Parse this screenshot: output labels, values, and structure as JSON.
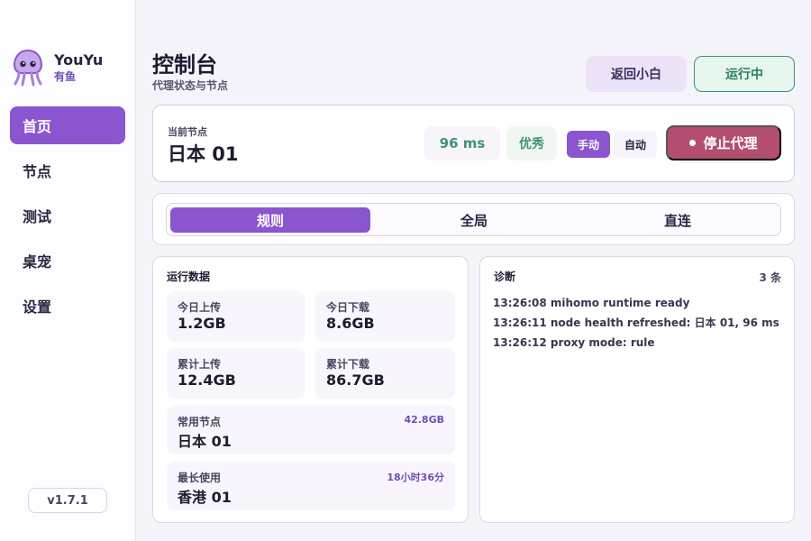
{
  "brand": {
    "name": "YouYu",
    "sub": "有鱼"
  },
  "sidebar": {
    "items": [
      {
        "label": "首页",
        "active": true
      },
      {
        "label": "节点",
        "active": false
      },
      {
        "label": "测试",
        "active": false
      },
      {
        "label": "桌宠",
        "active": false
      },
      {
        "label": "设置",
        "active": false
      }
    ],
    "version": "v1.7.1"
  },
  "header": {
    "title": "控制台",
    "subtitle": "代理状态与节点",
    "back_label": "返回小白",
    "status_label": "运行中"
  },
  "current_node": {
    "label": "当前节点",
    "name": "日本 01",
    "latency": "96 ms",
    "quality": "优秀",
    "mode_manual": "手动",
    "mode_auto": "自动",
    "selected_mode": "手动",
    "stop_label": "停止代理"
  },
  "routing": {
    "tabs": [
      "规则",
      "全局",
      "直连"
    ],
    "active": "规则"
  },
  "stats": {
    "title": "运行数据",
    "today_upload": {
      "label": "今日上传",
      "value": "1.2GB"
    },
    "today_download": {
      "label": "今日下载",
      "value": "8.6GB"
    },
    "total_upload": {
      "label": "累计上传",
      "value": "12.4GB"
    },
    "total_download": {
      "label": "累计下载",
      "value": "86.7GB"
    },
    "frequent_node": {
      "label": "常用节点",
      "value": "日本 01",
      "extra": "42.8GB"
    },
    "longest_used": {
      "label": "最长使用",
      "value": "香港 01",
      "extra": "18小时36分"
    }
  },
  "diagnostics": {
    "title": "诊断",
    "count": "3 条",
    "logs": [
      "13:26:08 mihomo runtime ready",
      "13:26:11 node health refreshed: 日本 01, 96 ms",
      "13:26:12 proxy mode: rule"
    ]
  },
  "colors": {
    "accent": "#8a55cf",
    "success": "#3d9473",
    "danger": "#b34e72"
  }
}
